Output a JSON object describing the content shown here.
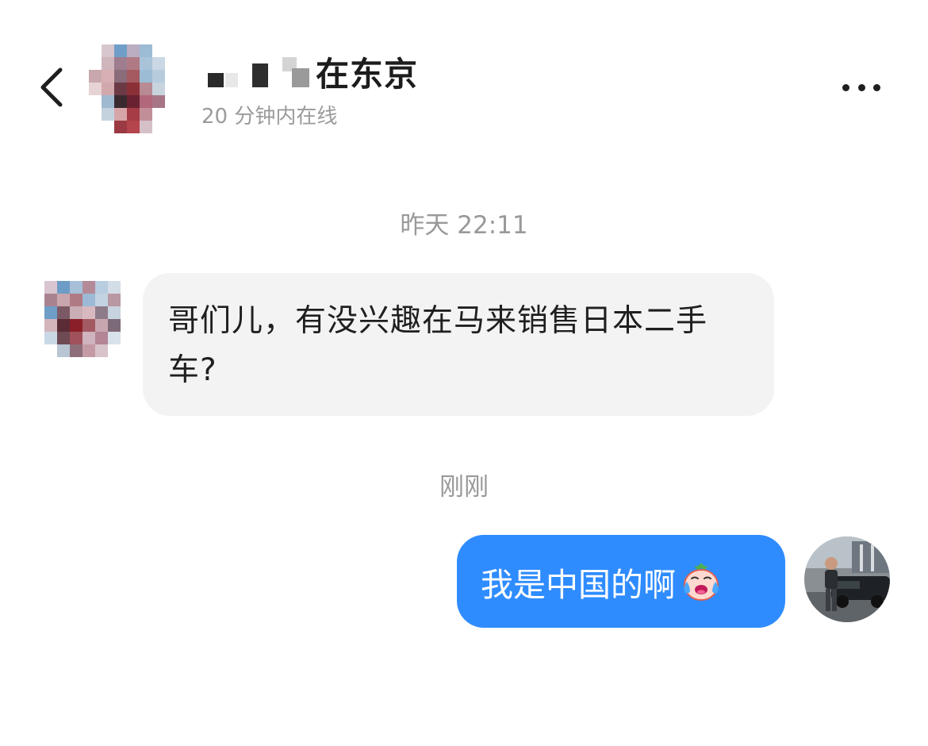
{
  "header": {
    "name_visible_suffix": "在东京",
    "status": "20 分钟内在线"
  },
  "messages": [
    {
      "timestamp": "昨天 22:11",
      "direction": "incoming",
      "text": "哥们儿，有没兴趣在马来销售日本二手车?"
    },
    {
      "timestamp": "刚刚",
      "direction": "outgoing",
      "text": "我是中国的啊",
      "emoji": "crying-laughing-peach-emoji"
    }
  ],
  "colors": {
    "outgoing_bubble": "#2f8cff",
    "incoming_bubble": "#f3f3f3",
    "timestamp": "#999999",
    "status": "#9b9b9b"
  },
  "icons": {
    "back": "chevron-left-icon",
    "more": "more-dots-icon",
    "header_avatar": "pixelated-avatar",
    "sender_avatar": "pixelated-avatar",
    "own_avatar": "photo-avatar-man-with-car"
  }
}
